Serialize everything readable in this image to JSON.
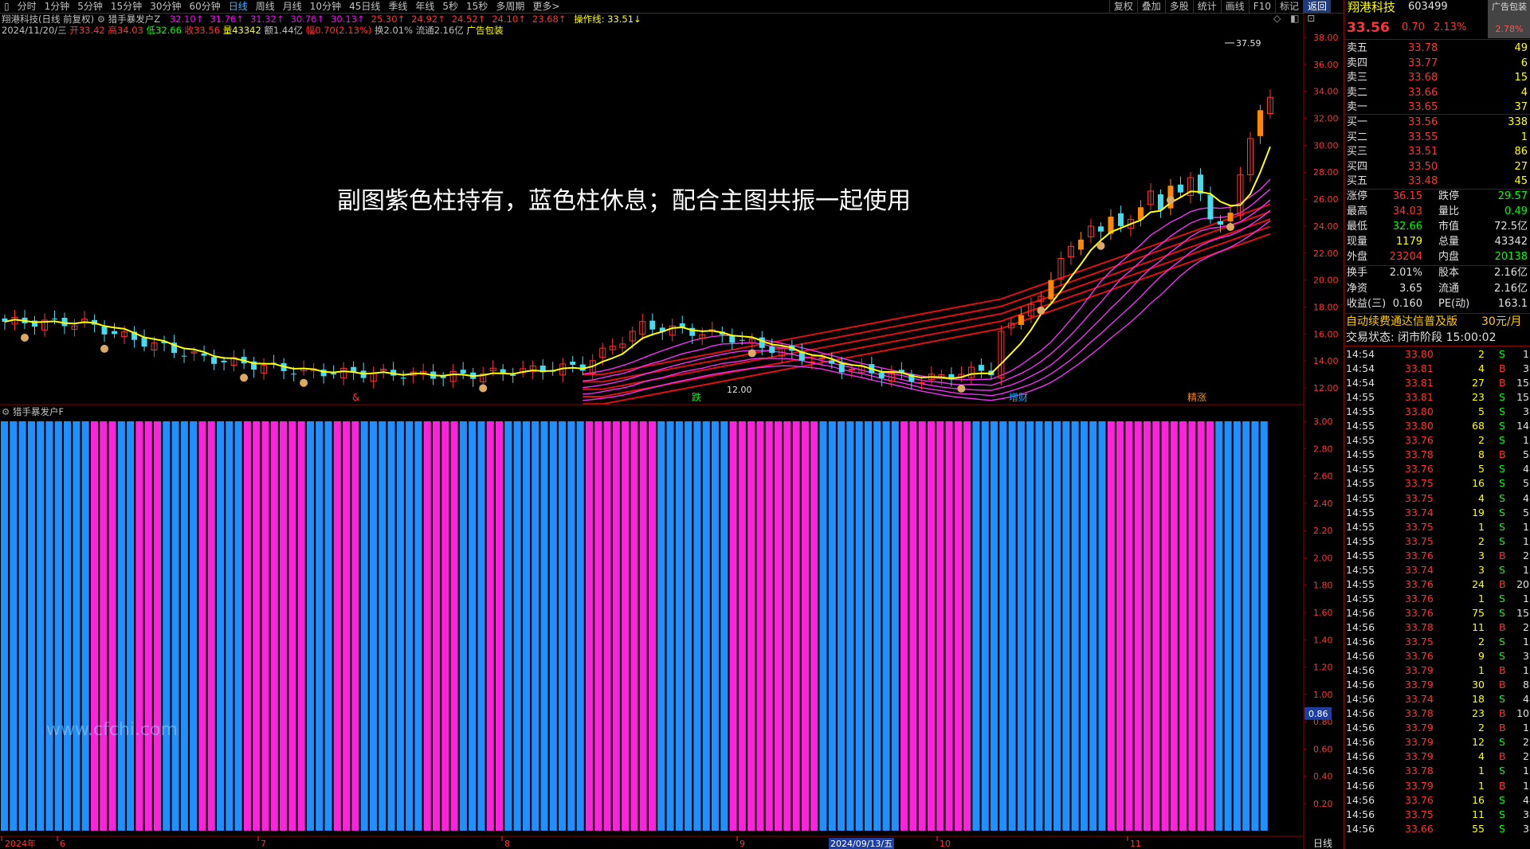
{
  "toolbar": {
    "periods": [
      "分时",
      "1分钟",
      "5分钟",
      "15分钟",
      "30分钟",
      "60分钟",
      "日线",
      "周线",
      "月线",
      "10分钟",
      "45日线",
      "季线",
      "年线",
      "5秒",
      "15秒",
      "多周期",
      "更多>"
    ],
    "active_index": 6,
    "right_buttons": [
      "复权",
      "叠加",
      "多股",
      "统计",
      "画线",
      "F10",
      "标记",
      "返回"
    ]
  },
  "main_chart": {
    "header_stock": "翔港科技(日线 前复权)",
    "header_indicator": "猎手暴发户Z",
    "ma_values": [
      "32.10↑",
      "31.76↑",
      "31.32↑",
      "30.76↑",
      "30.13↑",
      "25.30↑",
      "24.92↑",
      "24.52↑",
      "24.10↑",
      "23.68↑"
    ],
    "ma_colors": [
      "#ff00ff",
      "#ff00ff",
      "#ff00ff",
      "#ff00ff",
      "#ff00ff",
      "#ff3333",
      "#ff3333",
      "#ff3333",
      "#ff3333",
      "#ff3333"
    ],
    "op_line": "操作线: 33.51↓",
    "info": {
      "date": "2024/11/20/三",
      "open": "开33.42",
      "high": "高34.03",
      "low": "低32.66",
      "close": "收33.56",
      "vol": "量43342",
      "amount": "额1.44亿",
      "amp": "幅0.70(2.13%)",
      "turnover": "换2.01%",
      "float": "流通2.16亿",
      "ad": "广告包装"
    },
    "y_ticks": [
      "38.00",
      "36.00",
      "34.00",
      "32.00",
      "30.00",
      "28.00",
      "26.00",
      "24.00",
      "22.00",
      "20.00",
      "18.00",
      "16.00",
      "14.00",
      "12.00"
    ],
    "max_label": "37.59",
    "min_label": "12.00",
    "bottom_labels": [
      "&",
      "跌",
      "增财",
      "精涨"
    ],
    "overlay_text": "副图紫色柱持有，蓝色柱休息；配合主图共振一起使用"
  },
  "sub_chart": {
    "title": "猎手暴发户F",
    "y_ticks": [
      "3.00",
      "2.80",
      "2.60",
      "2.40",
      "2.20",
      "2.00",
      "1.80",
      "1.60",
      "1.40",
      "1.20",
      "1.00",
      "0.80",
      "0.60",
      "0.40",
      "0.20"
    ],
    "current_value": "0.86",
    "watermark": "www.cfchi.com",
    "colors_legend": {
      "hold": "#ff22dd",
      "rest": "#1e90ff"
    },
    "bars": "BBBBBBBBBBMMMBBMMMBBBBMMBBBMMMMMMMBBBMMMBBBBBBBMMMMBBBMMBBBBBBBBBMMMMMMMMBBBBBBBBMMMMMMMMMMBBBBBBBBBMMMMMMMMBBBBBBBBBBBBBBBMMMMMMMMMMMMBBBBBB"
  },
  "time_axis": {
    "labels": [
      "2024年",
      "6",
      "7",
      "8",
      "9",
      "2024/09/13/五",
      "10",
      "11"
    ],
    "period": "日线"
  },
  "panel": {
    "name": "翔港科技",
    "code": "603499",
    "ad_badge": "广告包装",
    "price": "33.56",
    "change": "0.70",
    "change_pct": "2.13%",
    "badge_pct": "2.78%",
    "sells": [
      {
        "label": "卖五",
        "price": "33.78",
        "vol": "49"
      },
      {
        "label": "卖四",
        "price": "33.77",
        "vol": "6"
      },
      {
        "label": "卖三",
        "price": "33.68",
        "vol": "15"
      },
      {
        "label": "卖二",
        "price": "33.66",
        "vol": "4"
      },
      {
        "label": "卖一",
        "price": "33.65",
        "vol": "37"
      }
    ],
    "buys": [
      {
        "label": "买一",
        "price": "33.56",
        "vol": "338"
      },
      {
        "label": "买二",
        "price": "33.55",
        "vol": "1"
      },
      {
        "label": "买三",
        "price": "33.51",
        "vol": "86"
      },
      {
        "label": "买四",
        "price": "33.50",
        "vol": "27"
      },
      {
        "label": "买五",
        "price": "33.48",
        "vol": "45"
      }
    ],
    "stats": [
      {
        "l1": "涨停",
        "v1": "36.15",
        "c1": "red",
        "l2": "跌停",
        "v2": "29.57",
        "c2": "grn"
      },
      {
        "l1": "最高",
        "v1": "34.03",
        "c1": "red",
        "l2": "量比",
        "v2": "0.49",
        "c2": "grn"
      },
      {
        "l1": "最低",
        "v1": "32.66",
        "c1": "grn",
        "l2": "市值",
        "v2": "72.5亿",
        "c2": "wht"
      },
      {
        "l1": "现量",
        "v1": "1179",
        "c1": "yel",
        "l2": "总量",
        "v2": "43342",
        "c2": "wht"
      },
      {
        "l1": "外盘",
        "v1": "23204",
        "c1": "red",
        "l2": "内盘",
        "v2": "20138",
        "c2": "grn"
      }
    ],
    "stats2": [
      {
        "l1": "换手",
        "v1": "2.01%",
        "l2": "股本",
        "v2": "2.16亿"
      },
      {
        "l1": "净资",
        "v1": "3.65",
        "l2": "流通",
        "v2": "2.16亿"
      },
      {
        "l1": "收益(三)",
        "v1": "0.160",
        "l2": "PE(动)",
        "v2": "163.1"
      }
    ],
    "promo": "自动续费通达信普及版",
    "promo_price": "30元/月",
    "trade_status": "交易状态: 闭市阶段 15:00:02",
    "trades": [
      [
        "14:54",
        "33.80",
        "2",
        "S",
        "1"
      ],
      [
        "14:54",
        "33.81",
        "4",
        "B",
        "3"
      ],
      [
        "14:54",
        "33.81",
        "27",
        "B",
        "15"
      ],
      [
        "14:55",
        "33.81",
        "23",
        "S",
        "15"
      ],
      [
        "14:55",
        "33.80",
        "5",
        "S",
        "3"
      ],
      [
        "14:55",
        "33.80",
        "68",
        "S",
        "14"
      ],
      [
        "14:55",
        "33.76",
        "2",
        "S",
        "1"
      ],
      [
        "14:55",
        "33.78",
        "8",
        "B",
        "5"
      ],
      [
        "14:55",
        "33.76",
        "5",
        "S",
        "4"
      ],
      [
        "14:55",
        "33.75",
        "16",
        "S",
        "5"
      ],
      [
        "14:55",
        "33.75",
        "4",
        "S",
        "4"
      ],
      [
        "14:55",
        "33.74",
        "19",
        "S",
        "5"
      ],
      [
        "14:55",
        "33.75",
        "1",
        "S",
        "1"
      ],
      [
        "14:55",
        "33.75",
        "2",
        "S",
        "1"
      ],
      [
        "14:55",
        "33.76",
        "3",
        "B",
        "2"
      ],
      [
        "14:55",
        "33.74",
        "3",
        "S",
        "1"
      ],
      [
        "14:55",
        "33.76",
        "24",
        "B",
        "20"
      ],
      [
        "14:55",
        "33.76",
        "1",
        "S",
        "1"
      ],
      [
        "14:56",
        "33.76",
        "75",
        "S",
        "15"
      ],
      [
        "14:56",
        "33.78",
        "11",
        "B",
        "2"
      ],
      [
        "14:56",
        "33.75",
        "2",
        "S",
        "1"
      ],
      [
        "14:56",
        "33.76",
        "9",
        "S",
        "3"
      ],
      [
        "14:56",
        "33.79",
        "1",
        "B",
        "1"
      ],
      [
        "14:56",
        "33.79",
        "30",
        "B",
        "8"
      ],
      [
        "14:56",
        "33.74",
        "18",
        "S",
        "4"
      ],
      [
        "14:56",
        "33.78",
        "23",
        "B",
        "10"
      ],
      [
        "14:56",
        "33.79",
        "2",
        "B",
        "1"
      ],
      [
        "14:56",
        "33.79",
        "12",
        "S",
        "2"
      ],
      [
        "14:56",
        "33.79",
        "4",
        "B",
        "2"
      ],
      [
        "14:56",
        "33.78",
        "1",
        "S",
        "1"
      ],
      [
        "14:56",
        "33.79",
        "1",
        "B",
        "1"
      ],
      [
        "14:56",
        "33.76",
        "16",
        "S",
        "4"
      ],
      [
        "14:56",
        "33.75",
        "11",
        "S",
        "3"
      ],
      [
        "14:56",
        "33.66",
        "55",
        "S",
        "3"
      ]
    ]
  }
}
